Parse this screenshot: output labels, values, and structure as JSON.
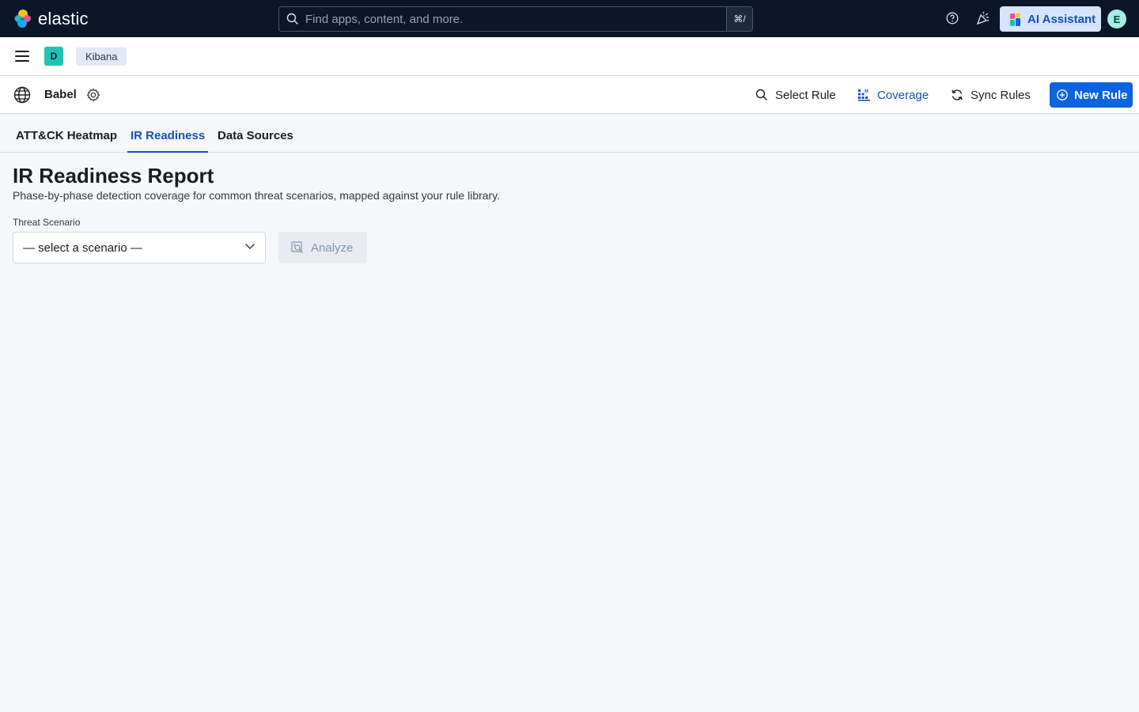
{
  "header": {
    "brand": "elastic",
    "search_placeholder": "Find apps, content, and more.",
    "search_shortcut": "⌘/",
    "ai_assistant_label": "AI Assistant",
    "avatar_initial": "E"
  },
  "nav": {
    "space_initial": "D",
    "breadcrumb": "Kibana"
  },
  "app": {
    "name": "Babel",
    "actions": {
      "select_rule": "Select Rule",
      "coverage": "Coverage",
      "sync_rules": "Sync Rules",
      "new_rule": "New Rule"
    }
  },
  "tabs": [
    {
      "label": "ATT&CK Heatmap",
      "active": false
    },
    {
      "label": "IR Readiness",
      "active": true
    },
    {
      "label": "Data Sources",
      "active": false
    }
  ],
  "main": {
    "title": "IR Readiness Report",
    "subtitle": "Phase-by-phase detection coverage for common threat scenarios, mapped against your rule library.",
    "scenario_label": "Threat Scenario",
    "scenario_value": "— select a scenario —",
    "analyze_label": "Analyze"
  },
  "colors": {
    "header_bg": "#0b1628",
    "accent": "#1750ba",
    "primary_button": "#0b64dd",
    "page_bg": "#f5f7fa"
  }
}
